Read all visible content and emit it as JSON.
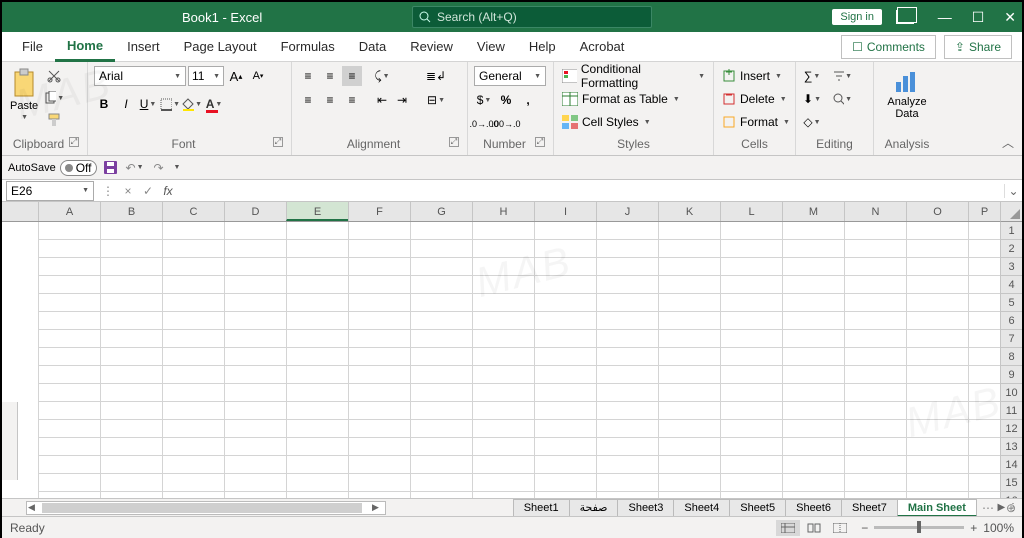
{
  "title": "Book1 - Excel",
  "search_placeholder": "Search (Alt+Q)",
  "signin": "Sign in",
  "tabs": [
    "File",
    "Home",
    "Insert",
    "Page Layout",
    "Formulas",
    "Data",
    "Review",
    "View",
    "Help",
    "Acrobat"
  ],
  "active_tab": "Home",
  "comments": "Comments",
  "share": "Share",
  "ribbon": {
    "paste": "Paste",
    "clipboard": "Clipboard",
    "font_name": "Arial",
    "font_size": "11",
    "font": "Font",
    "alignment": "Alignment",
    "number_format": "General",
    "number": "Number",
    "cond_fmt": "Conditional Formatting",
    "fmt_table": "Format as Table",
    "cell_styles": "Cell Styles",
    "styles": "Styles",
    "insert": "Insert",
    "delete": "Delete",
    "format": "Format",
    "cells": "Cells",
    "editing": "Editing",
    "analyze": "Analyze\nData",
    "analysis": "Analysis"
  },
  "autosave_label": "AutoSave",
  "autosave_state": "Off",
  "name_box": "E26",
  "columns": [
    "P",
    "O",
    "N",
    "M",
    "L",
    "K",
    "J",
    "I",
    "H",
    "G",
    "F",
    "E",
    "D",
    "C",
    "B",
    "A"
  ],
  "selected_col": "E",
  "row_count": 16,
  "sheet_tabs": [
    "Main Sheet",
    "Sheet7",
    "Sheet6",
    "Sheet5",
    "Sheet4",
    "Sheet3",
    "صفحة",
    "Sheet1"
  ],
  "active_sheet": "Main Sheet",
  "status": "Ready",
  "zoom": "100%",
  "watermark": "MAB"
}
